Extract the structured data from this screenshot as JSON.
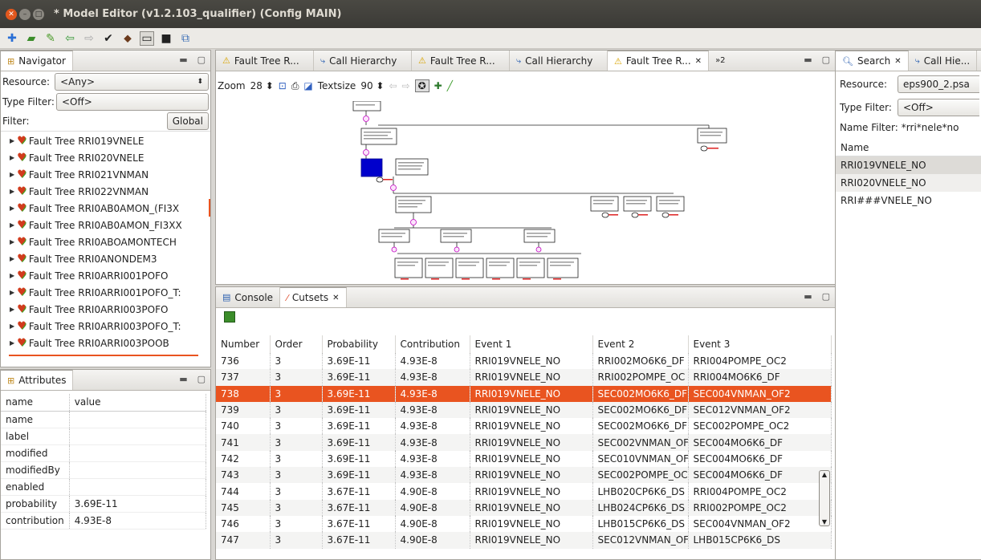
{
  "window": {
    "title": "* Model Editor (v1.2.103_qualifier)   (Config MAIN)"
  },
  "navigator": {
    "tab_label": "Navigator",
    "resource_label": "Resource:",
    "resource_value": "<Any>",
    "type_filter_label": "Type Filter:",
    "type_filter_value": "<Off>",
    "filter_label": "Filter:",
    "filter_value": "",
    "global_button": "Global",
    "items": [
      "Fault Tree RRI019VNELE",
      "Fault Tree RRI020VNELE",
      "Fault Tree RRI021VNMAN",
      "Fault Tree RRI022VNMAN",
      "Fault Tree RRI0AB0AMON_(FI3X",
      "Fault Tree RRI0AB0AMON_FI3XX",
      "Fault Tree RRI0ABOAMONTECH",
      "Fault Tree RRI0ANONDEM3",
      "Fault Tree RRI0ARRI001POFO",
      "Fault Tree RRI0ARRI001POFO_T:",
      "Fault Tree RRI0ARRI003POFO",
      "Fault Tree RRI0ARRI003POFO_T:",
      "Fault Tree RRI0ARRI003POOB"
    ]
  },
  "attributes": {
    "tab_label": "Attributes",
    "col_name": "name",
    "col_value": "value",
    "rows": [
      {
        "name": "name",
        "value": ""
      },
      {
        "name": "label",
        "value": ""
      },
      {
        "name": "modified",
        "value": ""
      },
      {
        "name": "modifiedBy",
        "value": ""
      },
      {
        "name": "enabled",
        "value": ""
      },
      {
        "name": "probability",
        "value": "3.69E-11"
      },
      {
        "name": "contribution",
        "value": "4.93E-8"
      }
    ]
  },
  "editor": {
    "tabs": [
      {
        "label": "Fault Tree R..."
      },
      {
        "label": "Call Hierarchy"
      },
      {
        "label": "Fault Tree R..."
      },
      {
        "label": "Call Hierarchy"
      },
      {
        "label": "Fault Tree R..."
      }
    ],
    "overflow_label": "»2",
    "zoom_label": "Zoom",
    "zoom_value": "28",
    "textsize_label": "Textsize",
    "textsize_value": "90"
  },
  "cutsets": {
    "console_tab": "Console",
    "cutsets_tab": "Cutsets",
    "columns": [
      "Number",
      "Order",
      "Probability",
      "Contribution",
      "Event 1",
      "Event 2",
      "Event 3"
    ],
    "selected_row": 2,
    "rows": [
      [
        "736",
        "3",
        "3.69E-11",
        "4.93E-8",
        "RRI019VNELE_NO",
        "RRI002MO6K6_DF",
        "RRI004POMPE_OC2"
      ],
      [
        "737",
        "3",
        "3.69E-11",
        "4.93E-8",
        "RRI019VNELE_NO",
        "RRI002POMPE_OC",
        "RRI004MO6K6_DF"
      ],
      [
        "738",
        "3",
        "3.69E-11",
        "4.93E-8",
        "RRI019VNELE_NO",
        "SEC002MO6K6_DF",
        "SEC004VNMAN_OF2"
      ],
      [
        "739",
        "3",
        "3.69E-11",
        "4.93E-8",
        "RRI019VNELE_NO",
        "SEC002MO6K6_DF",
        "SEC012VNMAN_OF2"
      ],
      [
        "740",
        "3",
        "3.69E-11",
        "4.93E-8",
        "RRI019VNELE_NO",
        "SEC002MO6K6_DF",
        "SEC002POMPE_OC2"
      ],
      [
        "741",
        "3",
        "3.69E-11",
        "4.93E-8",
        "RRI019VNELE_NO",
        "SEC002VNMAN_OF",
        "SEC004MO6K6_DF"
      ],
      [
        "742",
        "3",
        "3.69E-11",
        "4.93E-8",
        "RRI019VNELE_NO",
        "SEC010VNMAN_OF",
        "SEC004MO6K6_DF"
      ],
      [
        "743",
        "3",
        "3.69E-11",
        "4.93E-8",
        "RRI019VNELE_NO",
        "SEC002POMPE_OC",
        "SEC004MO6K6_DF"
      ],
      [
        "744",
        "3",
        "3.67E-11",
        "4.90E-8",
        "RRI019VNELE_NO",
        "LHB020CP6K6_DS",
        "RRI004POMPE_OC2"
      ],
      [
        "745",
        "3",
        "3.67E-11",
        "4.90E-8",
        "RRI019VNELE_NO",
        "LHB024CP6K6_DS",
        "RRI002POMPE_OC2"
      ],
      [
        "746",
        "3",
        "3.67E-11",
        "4.90E-8",
        "RRI019VNELE_NO",
        "LHB015CP6K6_DS",
        "SEC004VNMAN_OF2"
      ],
      [
        "747",
        "3",
        "3.67E-11",
        "4.90E-8",
        "RRI019VNELE_NO",
        "SEC012VNMAN_OF",
        "LHB015CP6K6_DS"
      ]
    ]
  },
  "search": {
    "tab_label": "Search",
    "tab2_label": "Call Hie...",
    "resource_label": "Resource:",
    "resource_value": "eps900_2.psa",
    "type_filter_label": "Type Filter:",
    "type_filter_value": "<Off>",
    "name_filter_label": "Name Filter:",
    "name_filter_value": "*rri*nele*no",
    "column": "Name",
    "results": [
      "RRI019VNELE_NO",
      "RRI020VNELE_NO",
      "RRI###VNELE_NO"
    ]
  },
  "colors": {
    "accent": "#e95420",
    "selection_blue": "#0000cc"
  }
}
